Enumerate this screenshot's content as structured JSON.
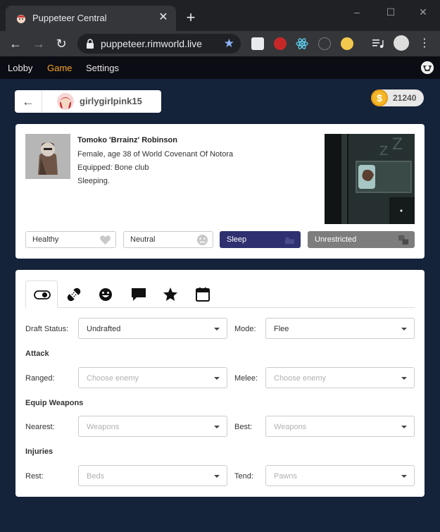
{
  "browser": {
    "tab_title": "Puppeteer Central",
    "tab_close": "✕",
    "new_tab": "+",
    "url": "puppeteer.rimworld.live",
    "window_controls": [
      "–",
      "☐",
      "✕"
    ]
  },
  "nav": {
    "items": [
      "Lobby",
      "Game",
      "Settings"
    ],
    "active": "Game"
  },
  "user": {
    "name": "girlygirlpink15",
    "coins": "21240",
    "coin_symbol": "$"
  },
  "pawn": {
    "name": "Tomoko 'Brrainz' Robinson",
    "description": "Female, age 38 of World Covenant Of Notora",
    "equipped": "Equipped: Bone club",
    "activity": "Sleeping."
  },
  "status": {
    "health": "Healthy",
    "mood": "Neutral",
    "schedule": "Sleep",
    "area": "Unrestricted"
  },
  "controls": {
    "tabs": [
      "toggle-icon",
      "bandage-icon",
      "smiley-icon",
      "speech-bubble-icon",
      "star-icon",
      "calendar-icon"
    ],
    "draft_label": "Draft Status:",
    "draft_value": "Undrafted",
    "mode_label": "Mode:",
    "mode_value": "Flee",
    "attack_section": "Attack",
    "ranged_label": "Ranged:",
    "ranged_placeholder": "Choose enemy",
    "melee_label": "Melee:",
    "melee_placeholder": "Choose enemy",
    "equip_section": "Equip Weapons",
    "nearest_label": "Nearest:",
    "nearest_placeholder": "Weapons",
    "best_label": "Best:",
    "best_placeholder": "Weapons",
    "injuries_section": "Injuries",
    "rest_label": "Rest:",
    "rest_placeholder": "Beds",
    "tend_label": "Tend:",
    "tend_placeholder": "Pawns"
  },
  "colors": {
    "page_bg": "#14223a",
    "nav_active": "#f5a623",
    "sleep_bg": "#2f3070",
    "unrestricted_bg": "#7d7d7d"
  }
}
